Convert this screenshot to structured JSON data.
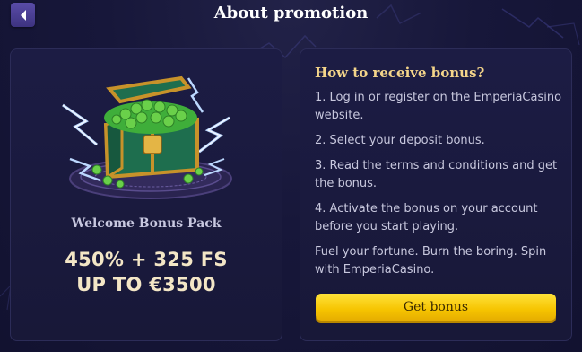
{
  "header": {
    "title": "About promotion",
    "back_icon": "chevron-left-icon"
  },
  "promo": {
    "image_icon": "treasure-chest-icon",
    "pack_title": "Welcome Bonus Pack",
    "offer_line1": "450% + 325 FS",
    "offer_line2": "UP TO €3500"
  },
  "instructions": {
    "title": "How to receive bonus?",
    "steps": [
      "1. Log in or register on the EmperiaCasino website.",
      "2. Select your deposit bonus.",
      "3. Read the terms and conditions and get the bonus.",
      "4. Activate the bonus on your account before you start playing."
    ],
    "tagline": "Fuel your fortune. Burn the boring. Spin with EmperiaCasino.",
    "button_label": "Get bonus"
  },
  "colors": {
    "background": "#151534",
    "card": "#1a1a3e",
    "accent_gold": "#f4d58a",
    "button_yellow": "#fcd200"
  }
}
